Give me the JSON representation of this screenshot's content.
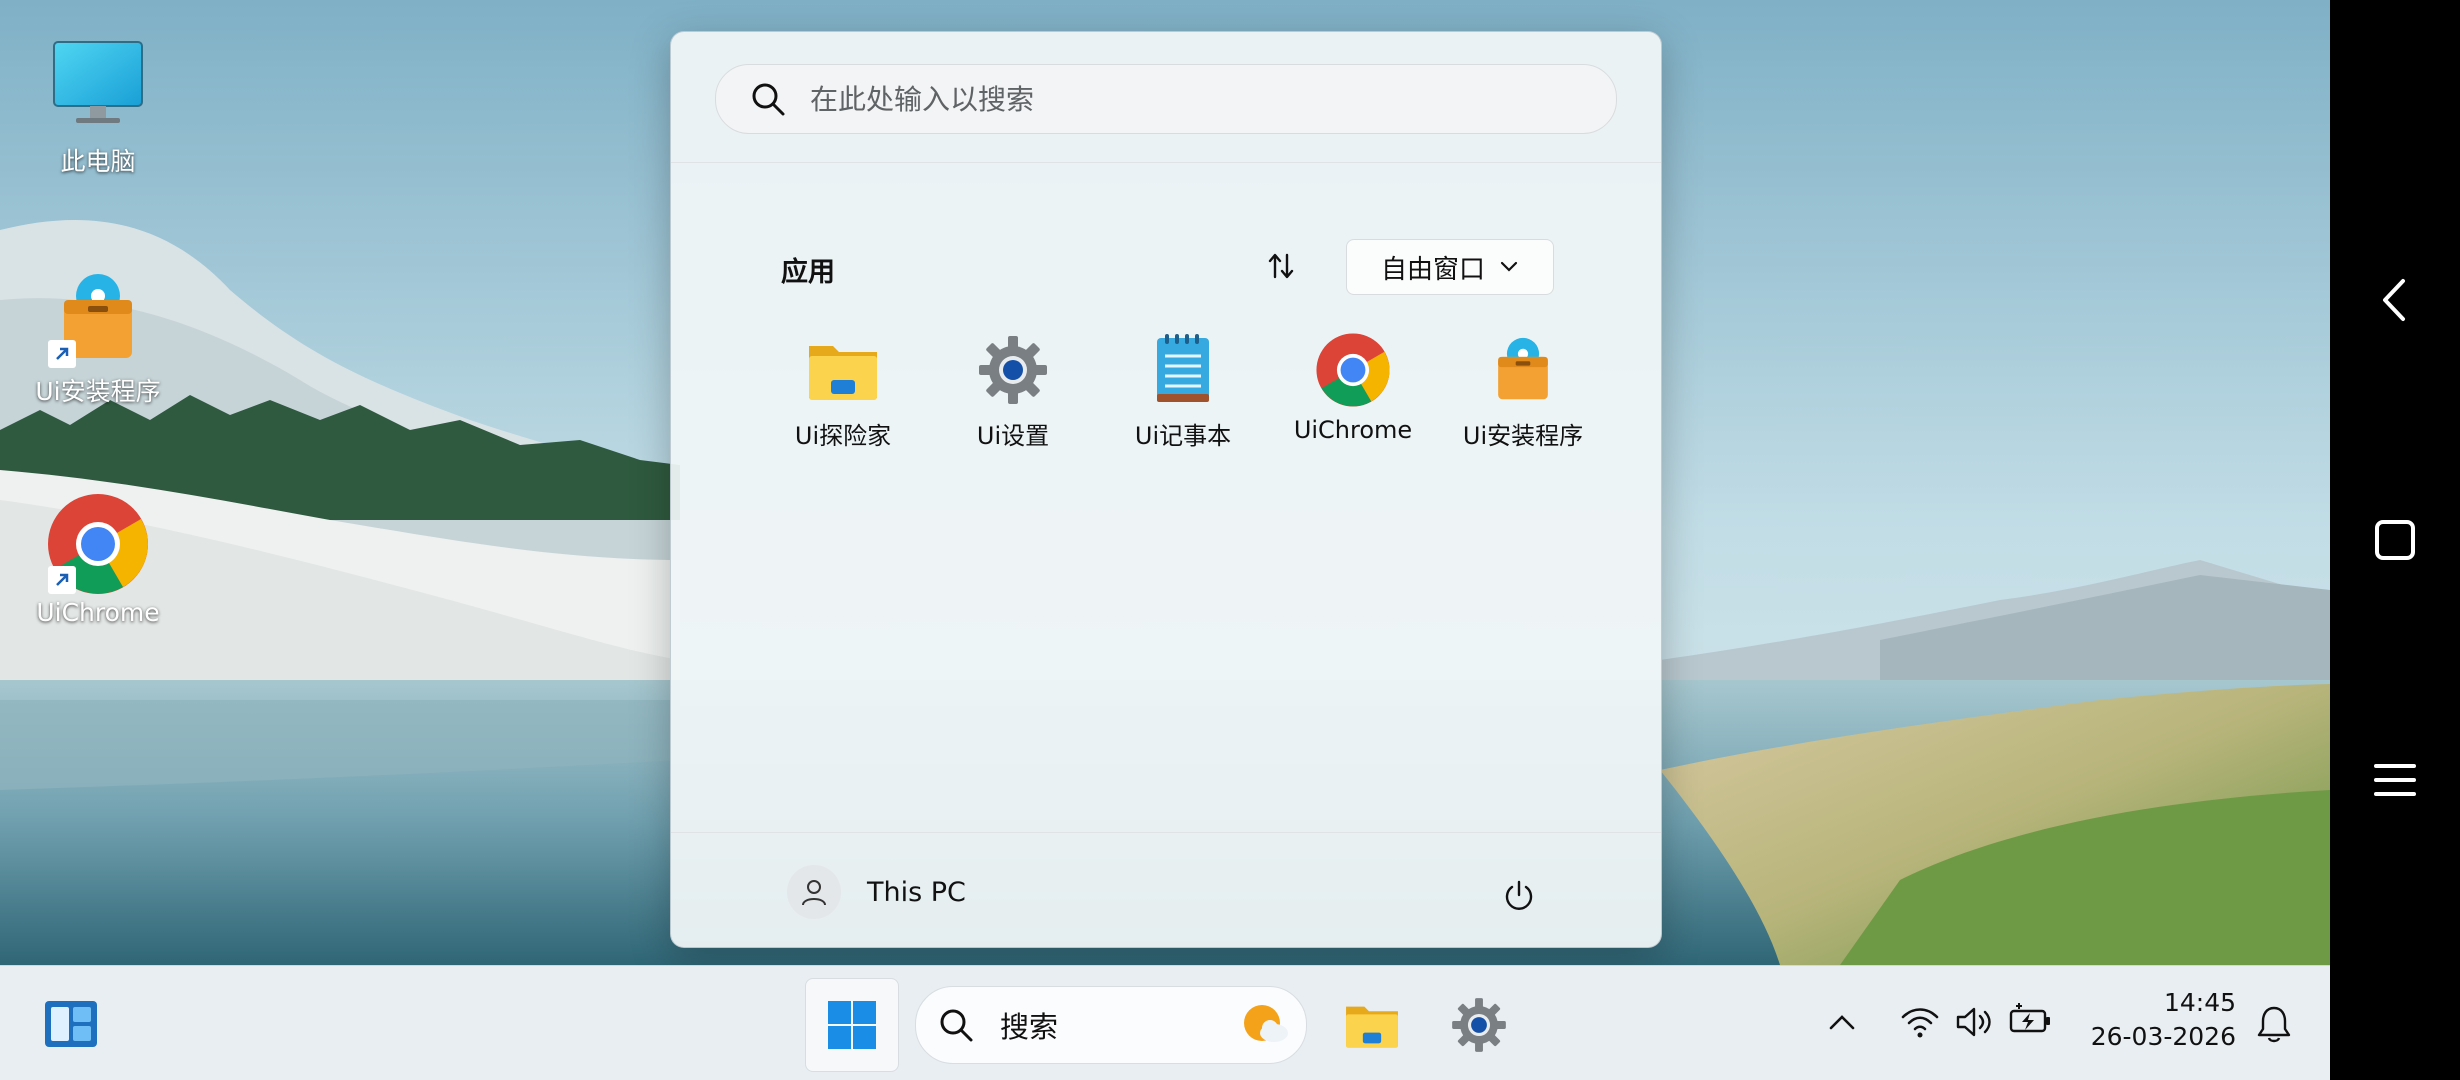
{
  "desktop": {
    "icons": [
      {
        "label": "此电脑",
        "icon": "monitor-icon"
      },
      {
        "label": "Ui安装程序",
        "icon": "installer-icon"
      },
      {
        "label": "UiChrome",
        "icon": "chrome-icon"
      }
    ]
  },
  "start_menu": {
    "search_placeholder": "在此处输入以搜索",
    "apps_header": "应用",
    "sort_icon": "sort-icon",
    "view_dropdown": "自由窗口",
    "apps": [
      {
        "label": "Ui探险家",
        "icon": "folder-icon"
      },
      {
        "label": "Ui设置",
        "icon": "settings-gear-icon"
      },
      {
        "label": "Ui记事本",
        "icon": "notepad-icon"
      },
      {
        "label": "UiChrome",
        "icon": "chrome-icon"
      },
      {
        "label": "Ui安装程序",
        "icon": "installer-icon"
      }
    ],
    "user_name": "This PC",
    "power_icon": "power-icon"
  },
  "taskbar": {
    "search_label": "搜索",
    "time": "14:45",
    "date": "26-03-2026"
  },
  "colors": {
    "accent": "#0078d4",
    "folder_yellow": "#f5c518",
    "taskbar_bg": "#e8eef2"
  }
}
